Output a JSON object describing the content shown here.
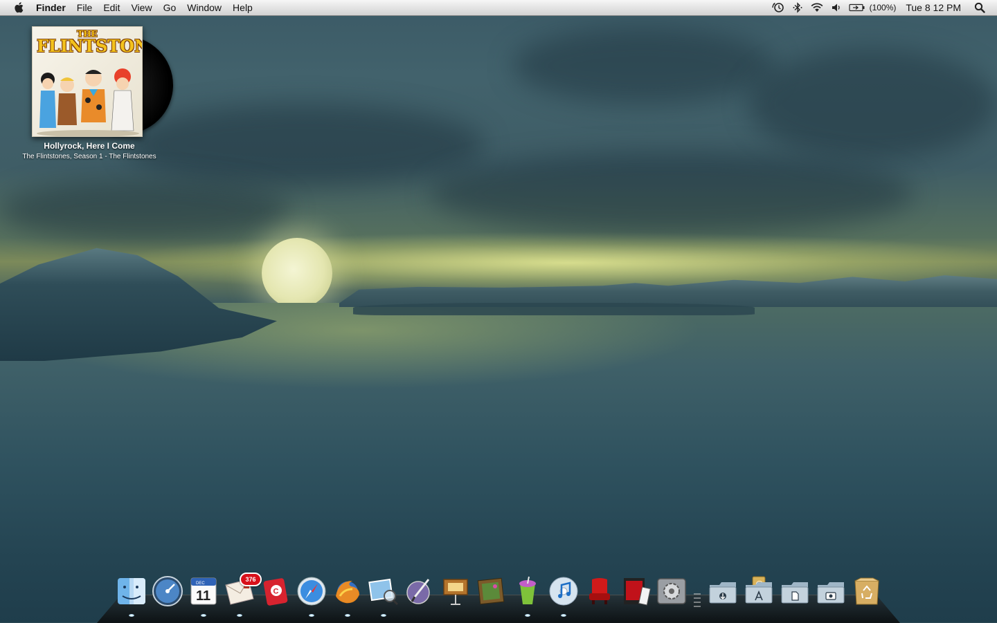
{
  "menubar": {
    "apple_icon": "apple-logo-icon",
    "app_name": "Finder",
    "menus": [
      "File",
      "Edit",
      "View",
      "Go",
      "Window",
      "Help"
    ],
    "status": {
      "battery_percent": "(100%)",
      "clock": "Tue 8 12 PM",
      "icons": [
        "time-machine-icon",
        "bluetooth-icon",
        "wifi-icon",
        "volume-icon",
        "battery-icon",
        "spotlight-icon"
      ]
    }
  },
  "now_playing": {
    "album_the": "THE",
    "album_main": "FLINTSTONES",
    "track": "Hollyrock, Here I Come",
    "subtitle": "The Flintstones, Season 1 - The Flintstones"
  },
  "dock": {
    "apps": [
      {
        "name": "finder",
        "running": true
      },
      {
        "name": "dashboard",
        "running": false
      },
      {
        "name": "ical",
        "running": true,
        "cal_month": "DEC",
        "cal_day": "11"
      },
      {
        "name": "mail",
        "running": true,
        "badge": "376"
      },
      {
        "name": "addressbook",
        "running": false
      },
      {
        "name": "safari",
        "running": true
      },
      {
        "name": "firefox",
        "running": true
      },
      {
        "name": "preview",
        "running": true
      },
      {
        "name": "script-editor",
        "running": false
      },
      {
        "name": "keynote",
        "running": false
      },
      {
        "name": "iphoto",
        "running": false
      },
      {
        "name": "slurp-drink",
        "running": true
      },
      {
        "name": "itunes",
        "running": true
      },
      {
        "name": "front-row",
        "running": false
      },
      {
        "name": "photo-booth",
        "running": false
      },
      {
        "name": "system-preferences",
        "running": false
      }
    ],
    "folders": [
      "downloads-folder",
      "applications-folder",
      "documents-folder",
      "pictures-folder",
      "trash"
    ]
  },
  "colors": {
    "menubar": "#e4e4e4",
    "badge_red": "#d8101a",
    "album_yellow": "#f3c21c"
  }
}
